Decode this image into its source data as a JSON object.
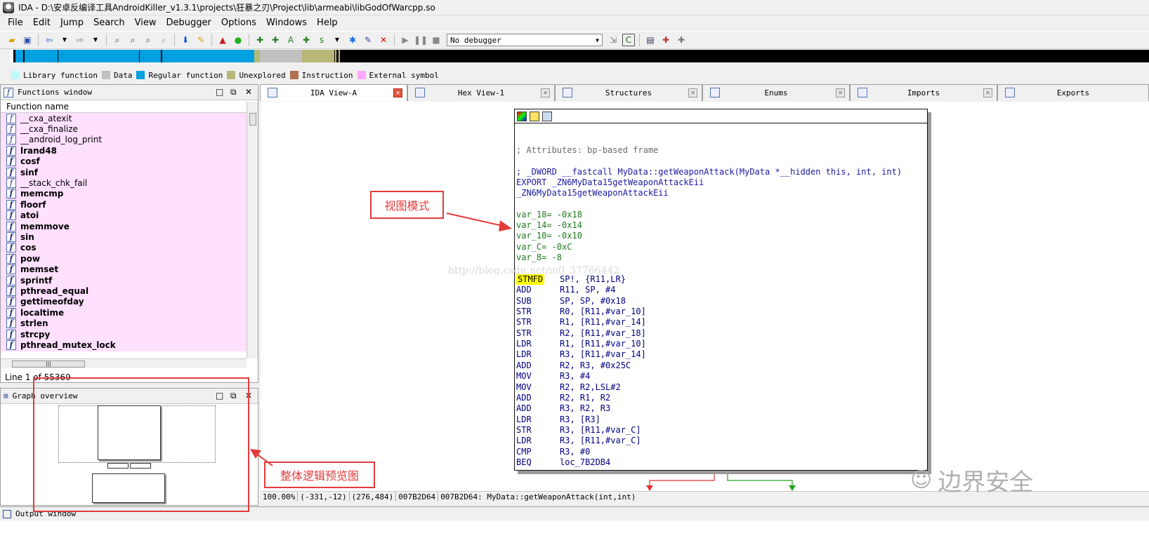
{
  "window": {
    "title": "IDA - D:\\安卓反编译工具AndroidKiller_v1.3.1\\projects\\狂暴之刃\\Project\\lib\\armeabi\\libGodOfWarcpp.so"
  },
  "menu": [
    "File",
    "Edit",
    "Jump",
    "Search",
    "View",
    "Debugger",
    "Options",
    "Windows",
    "Help"
  ],
  "toolbar": {
    "debugger_select": "No debugger"
  },
  "legend": [
    {
      "label": "Library function",
      "color": "#c0f8ff"
    },
    {
      "label": "Data",
      "color": "#c0c0c0"
    },
    {
      "label": "Regular function",
      "color": "#00a0e0"
    },
    {
      "label": "Unexplored",
      "color": "#b8b878"
    },
    {
      "label": "Instruction",
      "color": "#b07050"
    },
    {
      "label": "External symbol",
      "color": "#ffa8ff"
    }
  ],
  "functions_window": {
    "title": "Functions window",
    "column": "Function name",
    "items": [
      "__cxa_atexit",
      "__cxa_finalize",
      "__android_log_print",
      "lrand48",
      "cosf",
      "sinf",
      "__stack_chk_fail",
      "memcmp",
      "floorf",
      "atoi",
      "memmove",
      "sin",
      "cos",
      "pow",
      "memset",
      "sprintf",
      "pthread_equal",
      "gettimeofday",
      "localtime",
      "strlen",
      "strcpy",
      "pthread_mutex_lock"
    ],
    "status": "Line 1 of 55369"
  },
  "graph_overview": {
    "title": "Graph overview"
  },
  "tabs": [
    {
      "label": "IDA View-A",
      "active": true
    },
    {
      "label": "Hex View-1",
      "active": false
    },
    {
      "label": "Structures",
      "active": false
    },
    {
      "label": "Enums",
      "active": false
    },
    {
      "label": "Imports",
      "active": false
    },
    {
      "label": "Exports",
      "active": false
    }
  ],
  "disasm": {
    "attributes": "; Attributes: bp-based frame",
    "proto": "; _DWORD __fastcall MyData::getWeaponAttack(MyData *__hidden this, int, int)",
    "export": "EXPORT _ZN6MyData15getWeaponAttackEii",
    "label": "_ZN6MyData15getWeaponAttackEii",
    "vars": [
      "var_18= -0x18",
      "var_14= -0x14",
      "var_10= -0x10",
      "var_C= -0xC",
      "var_8= -8"
    ],
    "watermark": "http://blog.csdn.net/m0_37766442",
    "instructions": [
      {
        "op": "STMFD",
        "args": "SP!, {R11,LR}"
      },
      {
        "op": "ADD",
        "args": "R11, SP, #4"
      },
      {
        "op": "SUB",
        "args": "SP, SP, #0x18"
      },
      {
        "op": "STR",
        "args": "R0, [R11,#var_10]"
      },
      {
        "op": "STR",
        "args": "R1, [R11,#var_14]"
      },
      {
        "op": "STR",
        "args": "R2, [R11,#var_18]"
      },
      {
        "op": "LDR",
        "args": "R1, [R11,#var_10]"
      },
      {
        "op": "LDR",
        "args": "R3, [R11,#var_14]"
      },
      {
        "op": "ADD",
        "args": "R2, R3, #0x25C"
      },
      {
        "op": "MOV",
        "args": "R3, #4"
      },
      {
        "op": "MOV",
        "args": "R2, R2,LSL#2"
      },
      {
        "op": "ADD",
        "args": "R2, R1, R2"
      },
      {
        "op": "ADD",
        "args": "R3, R2, R3"
      },
      {
        "op": "LDR",
        "args": "R3, [R3]"
      },
      {
        "op": "STR",
        "args": "R3, [R11,#var_C]"
      },
      {
        "op": "LDR",
        "args": "R3, [R11,#var_C]"
      },
      {
        "op": "CMP",
        "args": "R3, #0"
      },
      {
        "op": "BEQ",
        "args": "loc_7B2DB4"
      }
    ]
  },
  "statusbar": [
    "100.00%",
    "(-331,-12)",
    "(276,484)",
    "007B2D64",
    "007B2D64: MyData::getWeaponAttack(int,int)"
  ],
  "annotations": {
    "view_mode": "视图模式",
    "overview": "整体逻辑预览图"
  },
  "output_window": {
    "title": "Output window"
  },
  "watermark_brand": "边界安全"
}
